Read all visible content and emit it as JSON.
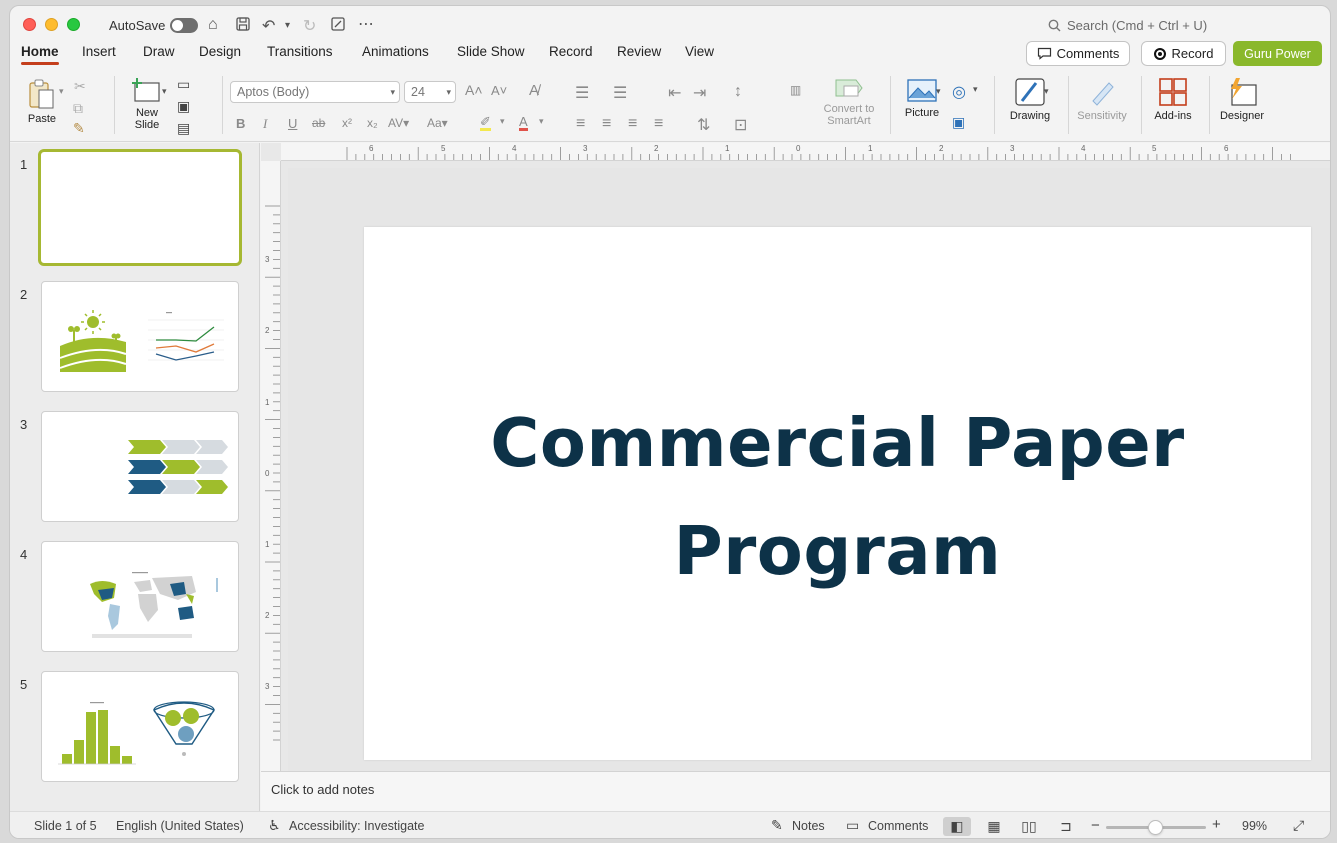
{
  "titlebar": {
    "autosave_label": "AutoSave",
    "search_placeholder": "Search (Cmd + Ctrl + U)"
  },
  "tabs": [
    {
      "label": "Home",
      "active": true
    },
    {
      "label": "Insert"
    },
    {
      "label": "Draw"
    },
    {
      "label": "Design"
    },
    {
      "label": "Transitions"
    },
    {
      "label": "Animations"
    },
    {
      "label": "Slide Show"
    },
    {
      "label": "Record"
    },
    {
      "label": "Review"
    },
    {
      "label": "View"
    }
  ],
  "header_buttons": {
    "comments": "Comments",
    "record": "Record",
    "guru": "Guru Power"
  },
  "ribbon": {
    "paste": "Paste",
    "new_slide_1": "New",
    "new_slide_2": "Slide",
    "font_name": "Aptos (Body)",
    "font_size": "24",
    "convert_1": "Convert to",
    "convert_2": "SmartArt",
    "picture": "Picture",
    "drawing": "Drawing",
    "sensitivity": "Sensitivity",
    "addins": "Add-ins",
    "designer": "Designer"
  },
  "ruler": {
    "h_labels": [
      "6",
      "5",
      "4",
      "3",
      "2",
      "1",
      "0",
      "1",
      "2",
      "3",
      "4",
      "5",
      "6"
    ],
    "v_labels": [
      "3",
      "2",
      "1",
      "0",
      "1",
      "2",
      "3"
    ]
  },
  "thumbnails": [
    {
      "number": "1",
      "selected": true
    },
    {
      "number": "2"
    },
    {
      "number": "3"
    },
    {
      "number": "4"
    },
    {
      "number": "5"
    }
  ],
  "slide": {
    "title_line1": "Commercial Paper",
    "title_line2": "Program"
  },
  "notes_placeholder": "Click to add notes",
  "status": {
    "slide_count": "Slide 1 of 5",
    "language": "English (United States)",
    "accessibility": "Accessibility: Investigate",
    "notes": "Notes",
    "comments": "Comments",
    "zoom": "99%"
  },
  "colors": {
    "accent_green": "#8ab82b",
    "title_navy": "#0d3248",
    "tab_underline": "#c43e1c"
  }
}
